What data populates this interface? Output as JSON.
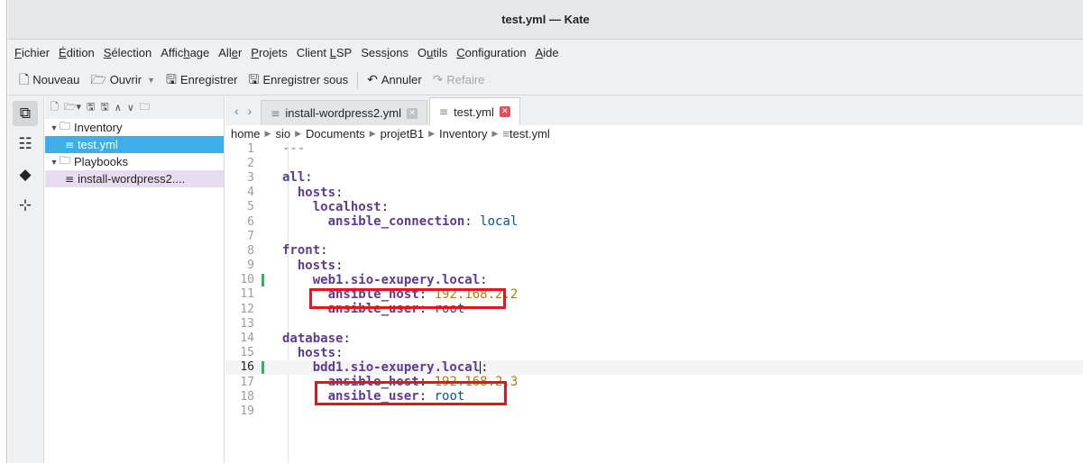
{
  "window": {
    "title": "test.yml — Kate"
  },
  "menu": [
    {
      "pre": "",
      "ul": "F",
      "post": "ichier"
    },
    {
      "pre": "",
      "ul": "É",
      "post": "dition"
    },
    {
      "pre": "",
      "ul": "S",
      "post": "élection"
    },
    {
      "pre": "Affic",
      "ul": "h",
      "post": "age"
    },
    {
      "pre": "All",
      "ul": "e",
      "post": "r"
    },
    {
      "pre": "",
      "ul": "P",
      "post": "rojets"
    },
    {
      "pre": "Client ",
      "ul": "L",
      "post": "SP"
    },
    {
      "pre": "Sess",
      "ul": "i",
      "post": "ons"
    },
    {
      "pre": "O",
      "ul": "u",
      "post": "tils"
    },
    {
      "pre": "",
      "ul": "C",
      "post": "onfiguration"
    },
    {
      "pre": "",
      "ul": "A",
      "post": "ide"
    }
  ],
  "toolbar": {
    "new_label": "Nouveau",
    "open_label": "Ouvrir",
    "save_label": "Enregistrer",
    "save_as_label": "Enregistrer sous",
    "undo_label": "Annuler",
    "redo_label": "Refaire"
  },
  "filetree": {
    "folder1": "Inventory",
    "file1": "test.yml",
    "folder2": "Playbooks",
    "file2": "install-wordpress2...."
  },
  "tabs": [
    {
      "label": "install-wordpress2.yml",
      "active": false
    },
    {
      "label": "test.yml",
      "active": true
    }
  ],
  "breadcrumb": [
    "home",
    "sio",
    "Documents",
    "projetB1",
    "Inventory",
    "test.yml"
  ],
  "editor": {
    "current_line": 16,
    "lines": [
      {
        "n": "1",
        "segs": [
          [
            "dash",
            "---"
          ]
        ]
      },
      {
        "n": "2",
        "segs": []
      },
      {
        "n": "3",
        "segs": [
          [
            "k",
            "all"
          ],
          [
            "p",
            ":"
          ]
        ]
      },
      {
        "n": "4",
        "segs": [
          [
            "p",
            "  "
          ],
          [
            "k",
            "hosts"
          ],
          [
            "p",
            ":"
          ]
        ]
      },
      {
        "n": "5",
        "segs": [
          [
            "p",
            "    "
          ],
          [
            "k",
            "localhost"
          ],
          [
            "p",
            ":"
          ]
        ]
      },
      {
        "n": "6",
        "segs": [
          [
            "p",
            "      "
          ],
          [
            "k",
            "ansible_connection"
          ],
          [
            "p",
            ": "
          ],
          [
            "s",
            "local"
          ]
        ]
      },
      {
        "n": "7",
        "segs": []
      },
      {
        "n": "8",
        "segs": [
          [
            "k",
            "front"
          ],
          [
            "p",
            ":"
          ]
        ]
      },
      {
        "n": "9",
        "segs": [
          [
            "p",
            "  "
          ],
          [
            "k",
            "hosts"
          ],
          [
            "p",
            ":"
          ]
        ]
      },
      {
        "n": "10",
        "segs": [
          [
            "p",
            "    "
          ],
          [
            "k",
            "web1.sio-exupery.local"
          ],
          [
            "p",
            ":"
          ]
        ],
        "mod": true
      },
      {
        "n": "11",
        "segs": [
          [
            "p",
            "      "
          ],
          [
            "k",
            "ansible_host"
          ],
          [
            "p",
            ": "
          ],
          [
            "n",
            "192.168.2.2"
          ]
        ]
      },
      {
        "n": "12",
        "segs": [
          [
            "p",
            "      "
          ],
          [
            "k",
            "ansible_user"
          ],
          [
            "p",
            ": "
          ],
          [
            "s",
            "root"
          ]
        ]
      },
      {
        "n": "13",
        "segs": []
      },
      {
        "n": "14",
        "segs": [
          [
            "k",
            "database"
          ],
          [
            "p",
            ":"
          ]
        ]
      },
      {
        "n": "15",
        "segs": [
          [
            "p",
            "  "
          ],
          [
            "k",
            "hosts"
          ],
          [
            "p",
            ":"
          ]
        ]
      },
      {
        "n": "16",
        "segs": [
          [
            "p",
            "    "
          ],
          [
            "k",
            "bdd1.sio-exupery.local"
          ],
          [
            "p",
            ":"
          ]
        ],
        "mod": true
      },
      {
        "n": "17",
        "segs": [
          [
            "p",
            "      "
          ],
          [
            "k",
            "ansible_host"
          ],
          [
            "p",
            ": "
          ],
          [
            "n",
            "192.168.2.3"
          ]
        ]
      },
      {
        "n": "18",
        "segs": [
          [
            "p",
            "      "
          ],
          [
            "k",
            "ansible_user"
          ],
          [
            "p",
            ": "
          ],
          [
            "s",
            "root"
          ]
        ]
      },
      {
        "n": "19",
        "segs": []
      }
    ]
  },
  "colors": {
    "highlight_box": "#e0171e",
    "selection": "#3daee9",
    "keyword": "#5a3c96",
    "string": "#0057ae",
    "number": "#b08000"
  }
}
